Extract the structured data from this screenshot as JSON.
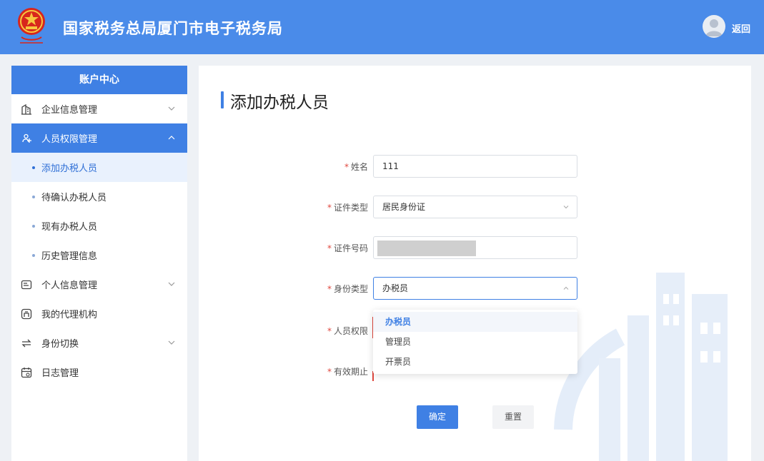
{
  "header": {
    "site_title": "国家税务总局厦门市电子税务局",
    "back_label": "返回",
    "emblem_icon": "tax-emblem-icon",
    "avatar_icon": "user-avatar-icon"
  },
  "sidebar": {
    "title": "账户中心",
    "items": [
      {
        "label": "企业信息管理",
        "icon": "building-icon",
        "expandable": true,
        "expanded": false
      },
      {
        "label": "人员权限管理",
        "icon": "people-permission-icon",
        "expandable": true,
        "expanded": true,
        "active": true,
        "children": [
          {
            "label": "添加办税人员",
            "current": true
          },
          {
            "label": "待确认办税人员"
          },
          {
            "label": "现有办税人员"
          },
          {
            "label": "历史管理信息"
          }
        ]
      },
      {
        "label": "个人信息管理",
        "icon": "id-card-icon",
        "expandable": true,
        "expanded": false
      },
      {
        "label": "我的代理机构",
        "icon": "agency-icon",
        "expandable": false
      },
      {
        "label": "身份切换",
        "icon": "switch-icon",
        "expandable": true,
        "expanded": false
      },
      {
        "label": "日志管理",
        "icon": "calendar-log-icon",
        "expandable": false
      }
    ]
  },
  "main": {
    "page_title": "添加办税人员",
    "form": {
      "name_label": "姓名",
      "name_value": "111",
      "id_type_label": "证件类型",
      "id_type_value": "居民身份证",
      "id_number_label": "证件号码",
      "identity_type_label": "身份类型",
      "identity_type_value": "办税员",
      "identity_type_options": [
        "办税员",
        "管理员",
        "开票员"
      ],
      "permission_label": "人员权限",
      "valid_until_label": "有效期止"
    },
    "buttons": {
      "confirm": "确定",
      "reset": "重置"
    }
  },
  "colors": {
    "header_bg": "#4a8be9",
    "accent": "#3f80e4",
    "required": "#e0483f"
  }
}
